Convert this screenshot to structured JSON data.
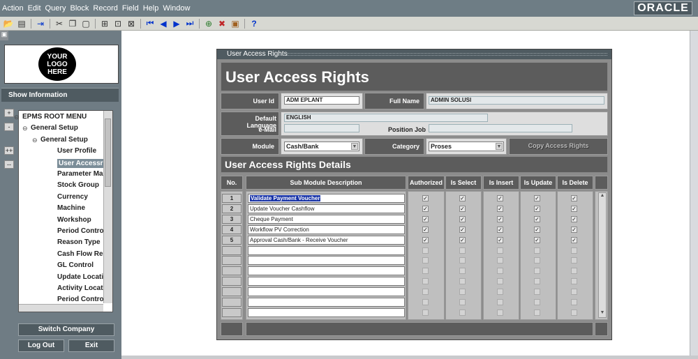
{
  "menubar": {
    "items": [
      "Action",
      "Edit",
      "Query",
      "Block",
      "Record",
      "Field",
      "Help",
      "Window"
    ],
    "brand": "ORACLE"
  },
  "sidebar": {
    "logo_text": "YOUR LOGO HERE",
    "show_information": "Show Information",
    "side_buttons": [
      "+",
      "-",
      "++",
      "--"
    ],
    "tree": [
      {
        "label": "EPMS ROOT MENU",
        "level": 0,
        "icon": "collapse-icon"
      },
      {
        "label": "General Setup",
        "level": 1,
        "icon": "collapse-icon"
      },
      {
        "label": "General Setup",
        "level": 2,
        "icon": "collapse-icon"
      },
      {
        "label": "User Profile",
        "level": 3
      },
      {
        "label": "User Accessrig",
        "level": 3,
        "selected": true
      },
      {
        "label": "Parameter Mast",
        "level": 3
      },
      {
        "label": "Stock Group",
        "level": 3
      },
      {
        "label": "Currency",
        "level": 3
      },
      {
        "label": "Machine",
        "level": 3
      },
      {
        "label": "Workshop",
        "level": 3
      },
      {
        "label": "Period Control",
        "level": 3
      },
      {
        "label": "Reason Type",
        "level": 3
      },
      {
        "label": "Cash Flow Repo",
        "level": 3
      },
      {
        "label": "GL Control",
        "level": 3
      },
      {
        "label": "Update Locatio",
        "level": 3
      },
      {
        "label": "Activity Locatio",
        "level": 3
      },
      {
        "label": "Period Control C",
        "level": 3
      }
    ],
    "switch_company": "Switch Company",
    "log_out": "Log Out",
    "exit": "Exit"
  },
  "form": {
    "window_title": "User Access Rights",
    "title": "User Access Rights",
    "user_id_label": "User Id",
    "user_id": "ADM EPLANT",
    "full_name_label": "Full Name",
    "full_name": "ADMIN SOLUSI",
    "default_language_label": "Default Language",
    "default_language": "ENGLISH",
    "email_label": "e-Mail",
    "email": "",
    "position_job_label": "Position Job",
    "position_job": "",
    "module_label": "Module",
    "module": "Cash/Bank",
    "category_label": "Category",
    "category": "Proses",
    "copy_button": "Copy Access Rights"
  },
  "details": {
    "title": "User Access Rights Details",
    "columns": {
      "no": "No.",
      "desc": "Sub Module Description",
      "authorized": "Authorized",
      "is_select": "Is Select",
      "is_insert": "Is Insert",
      "is_update": "Is Update",
      "is_delete": "Is Delete"
    },
    "rows": [
      {
        "no": "1",
        "desc": "Validate Payment Voucher",
        "checked": true,
        "selected": true
      },
      {
        "no": "2",
        "desc": "Update Voucher Cashflow",
        "checked": true
      },
      {
        "no": "3",
        "desc": "Cheque Payment",
        "checked": true
      },
      {
        "no": "4",
        "desc": "Workflow PV Correction",
        "checked": true
      },
      {
        "no": "5",
        "desc": "Approval Cash/Bank - Receive Voucher",
        "checked": true
      },
      {
        "no": "",
        "desc": "",
        "checked": false
      },
      {
        "no": "",
        "desc": "",
        "checked": false
      },
      {
        "no": "",
        "desc": "",
        "checked": false
      },
      {
        "no": "",
        "desc": "",
        "checked": false
      },
      {
        "no": "",
        "desc": "",
        "checked": false
      },
      {
        "no": "",
        "desc": "",
        "checked": false
      },
      {
        "no": "",
        "desc": "",
        "checked": false
      }
    ]
  }
}
